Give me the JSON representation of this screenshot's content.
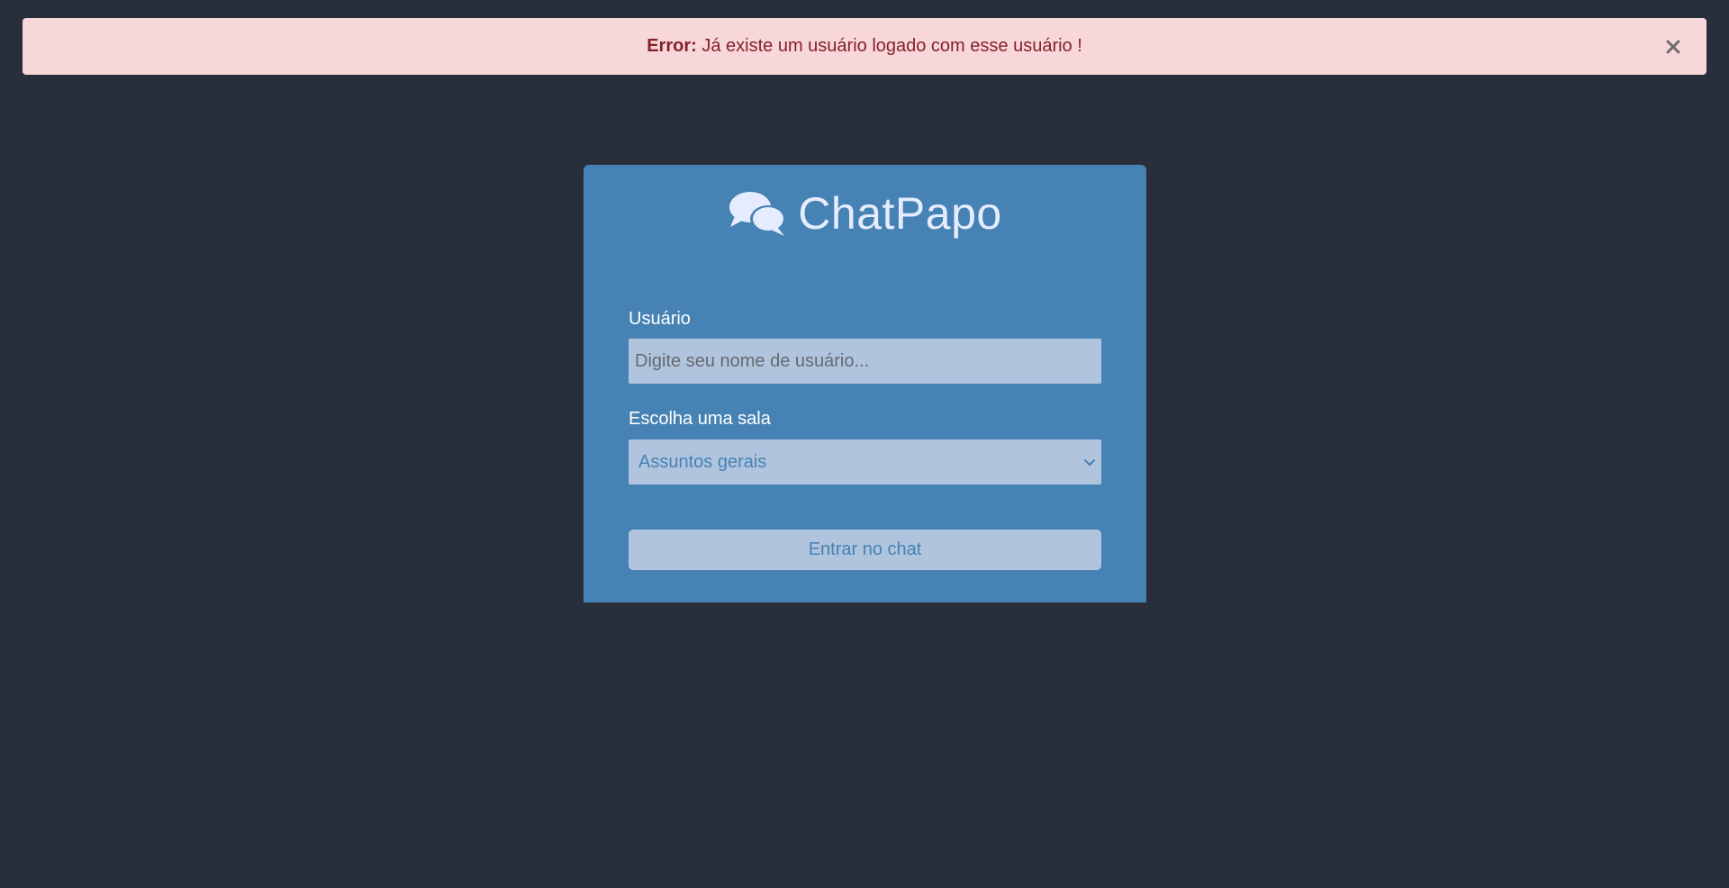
{
  "alert": {
    "prefix": "Error:",
    "message": " Já existe um usuário logado com esse usuário !",
    "close_icon": "close-icon"
  },
  "brand": {
    "icon": "comments-icon",
    "title": "ChatPapo"
  },
  "form": {
    "username_label": "Usuário",
    "username_placeholder": "Digite seu nome de usuário...",
    "username_value": "",
    "room_label": "Escolha uma sala",
    "room_selected": "Assuntos gerais",
    "submit_label": "Entrar no chat"
  },
  "colors": {
    "background": "#282f3b",
    "alert_bg": "#f8d7da",
    "alert_text": "#842029",
    "card_bg": "#4682b4",
    "field_bg": "#b0c4de",
    "brand_text": "#e6ecff"
  }
}
